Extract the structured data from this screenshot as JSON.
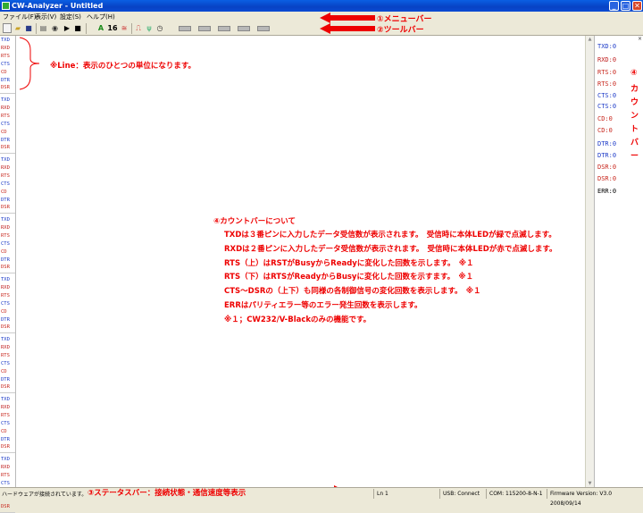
{
  "window": {
    "title": "CW-Analyzer - Untitled",
    "minimize": "_",
    "maximize": "□",
    "close": "✕"
  },
  "menu": [
    "ファイル(F)",
    "表示(V)",
    "設定(S)",
    "ヘルプ(H)"
  ],
  "toolbar": {
    "letter_a": "A",
    "num16": "16"
  },
  "line_signals": [
    "TXD",
    "RXD",
    "RTS",
    "CTS",
    "CD",
    "DTR",
    "DSR"
  ],
  "counters": [
    "TXD:0",
    "RXD:0",
    "RTS:0",
    "RTS:0",
    "CTS:0",
    "CTS:0",
    "CD:0",
    "CD:0",
    "DTR:0",
    "DTR:0",
    "DSR:0",
    "DSR:0",
    "ERR:0"
  ],
  "colors": {
    "txd": "#1e3cc8",
    "rxd": "#c02020",
    "rts": "#c8281e",
    "cts": "#1e3cc8",
    "cd": "#c8281e",
    "dtr": "#1e3cc8",
    "dsr": "#c8281e",
    "err": "#000000",
    "annotation": "#e00000",
    "titlebar": "#0A5FE3"
  },
  "annotations": {
    "menubar": "①メニューバー",
    "toolbar": "②ツールバー",
    "statusbar": "③ステータスバー：接続状態・通信速度等表示",
    "countbar_vertical": [
      "④",
      "カ",
      "ウ",
      "ン",
      "ト",
      "バ",
      "ー"
    ],
    "line_note": "※Line：表示のひとつの単位になります。",
    "desc_title": "④カウントバーについて",
    "desc_lines": [
      "TXDは３番ピンに入力したデータ受信数が表示されます。　受信時に本体LEDが緑で点滅します。",
      "RXDは２番ピンに入力したデータ受信数が表示されます。　受信時に本体LEDが赤で点滅します。",
      "RTS（上）はRSTがBusyからReadyに変化した回数を示します。　※１",
      "RTS（下）はRTSがReadyからBusyに変化した回数を示すます。　※１",
      "CTS～DSRの（上下）も同様の各制御信号の変化回数を表示します。　※１",
      "ERRはパリティエラー等のエラー発生回数を表示します。",
      "※１；CW232/V-Blackのみの機能です。"
    ]
  },
  "status": {
    "message": "ハードウェアが接続されています。",
    "ln": "Ln 1",
    "usb": "USB: Connect",
    "com": "COM: 115200-8-N-1",
    "firmware": "Firmware Version: V3.0 2008/09/14"
  }
}
